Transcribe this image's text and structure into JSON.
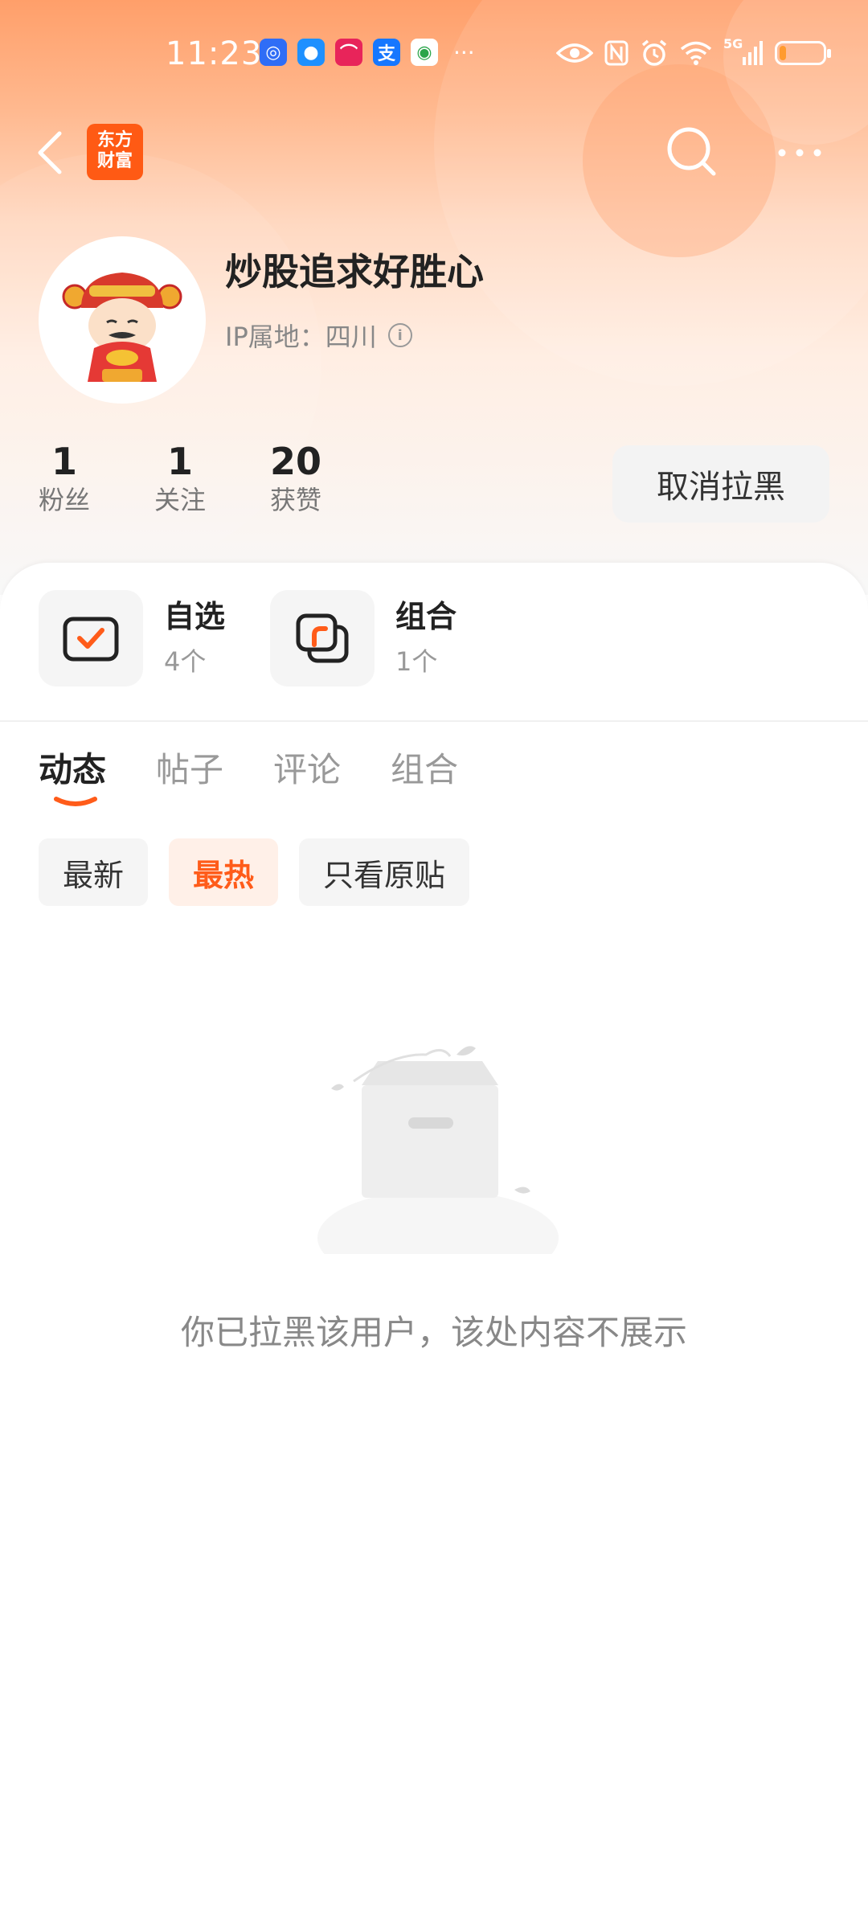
{
  "status_bar": {
    "time": "11:23",
    "more": "···",
    "network": "5G",
    "battery_level": 0.15,
    "app_icons": [
      "app-icon-1",
      "message-icon",
      "app-icon-3",
      "alipay-icon",
      "app-icon-5"
    ]
  },
  "nav": {
    "logo_line1": "东方",
    "logo_line2": "财富"
  },
  "profile": {
    "username": "炒股追求好胜心",
    "ip_label": "IP属地：四川",
    "info_glyph": "i"
  },
  "stats": [
    {
      "value": "1",
      "label": "粉丝"
    },
    {
      "value": "1",
      "label": "关注"
    },
    {
      "value": "20",
      "label": "获赞"
    }
  ],
  "unblock_button": "取消拉黑",
  "features": [
    {
      "title": "自选",
      "count": "4个"
    },
    {
      "title": "组合",
      "count": "1个"
    }
  ],
  "tabs": [
    "动态",
    "帖子",
    "评论",
    "组合"
  ],
  "filters": [
    "最新",
    "最热",
    "只看原贴"
  ],
  "empty_message": "你已拉黑该用户，该处内容不展示",
  "colors": {
    "accent": "#ff5c1a",
    "brand_logo": "#ff5a14"
  }
}
